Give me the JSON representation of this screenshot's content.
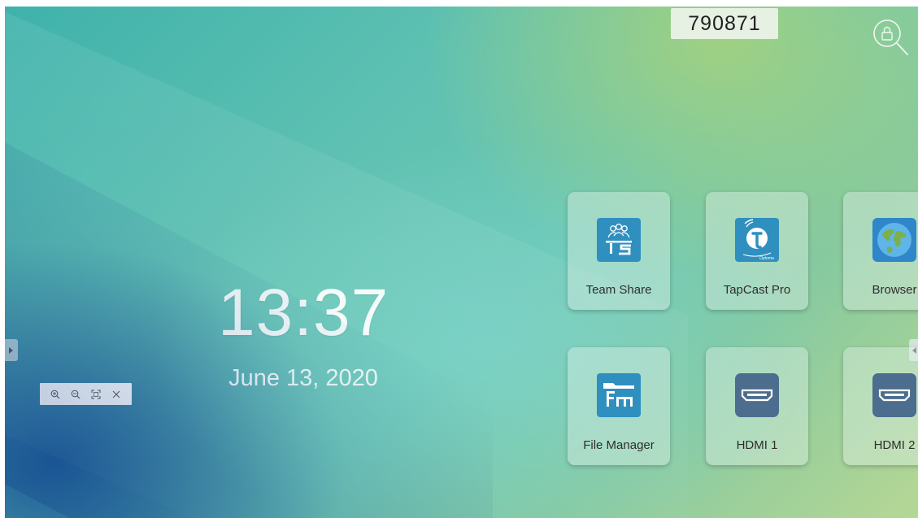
{
  "meeting_code": "790871",
  "clock": {
    "time": "13:37",
    "date": "June 13, 2020"
  },
  "apps": [
    {
      "label": "Team Share",
      "icon": "team-share-icon",
      "color": "#2f8fbf"
    },
    {
      "label": "TapCast Pro",
      "icon": "tapcast-pro-icon",
      "color": "#2f8fbf"
    },
    {
      "label": "Browser",
      "icon": "browser-globe-icon",
      "color": "#2f86c8"
    },
    {
      "label": "File Manager",
      "icon": "file-manager-icon",
      "color": "#2f8fbf"
    },
    {
      "label": "HDMI 1",
      "icon": "hdmi-icon",
      "color": "#4d6d8e"
    },
    {
      "label": "HDMI 2",
      "icon": "hdmi-icon",
      "color": "#4d6d8e"
    }
  ],
  "zoom_toolbar": [
    "zoom-in-icon",
    "zoom-out-icon",
    "fit-screen-icon",
    "close-icon"
  ],
  "lock_icon": "lock-search-icon"
}
